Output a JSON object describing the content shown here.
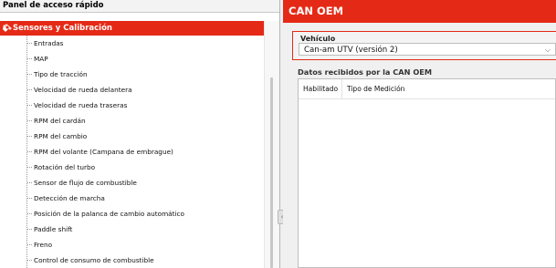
{
  "left_panel": {
    "title": "Panel de acceso rápido",
    "category": "Sensores y Calibración",
    "items": [
      "Entradas",
      "MAP",
      "Tipo de tracción",
      "Velocidad de rueda delantera",
      "Velocidad de rueda traseras",
      "RPM del cardán",
      "RPM del cambio",
      "RPM del volante (Campana de embrague)",
      "Rotación del turbo",
      "Sensor de flujo de combustible",
      "Detección de marcha",
      "Posición de la palanca de cambio automático",
      "Paddle shift",
      "Freno",
      "Control de consumo de combustible"
    ]
  },
  "right_panel": {
    "title": "CAN OEM",
    "vehicle": {
      "label": "Vehículo",
      "selected": "Can-am UTV (versión 2)"
    },
    "data_section": {
      "label": "Datos recibidos por la CAN OEM",
      "columns": [
        "Habilitado",
        "Tipo de Medición"
      ]
    }
  },
  "colors": {
    "accent": "#e42a16",
    "panel_bg": "#f0f0f0"
  }
}
